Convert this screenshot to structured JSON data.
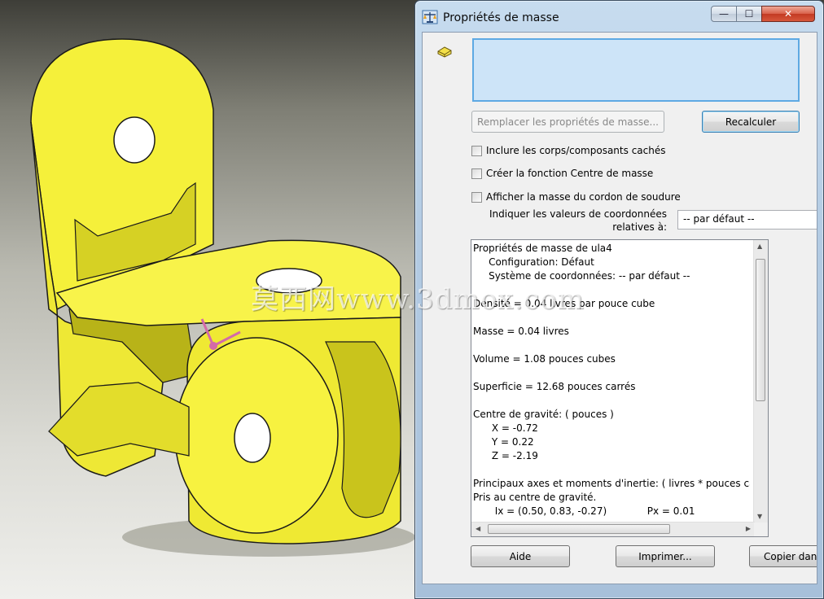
{
  "viewport": {
    "watermark": "莫西网www.3dmox.com"
  },
  "window": {
    "title": "Propriétés de masse",
    "minimize_glyph": "—",
    "maximize_glyph": "☐",
    "close_glyph": "✕"
  },
  "icons": {
    "title": "balance-scale-icon",
    "part": "part-icon"
  },
  "buttons": {
    "replace": "Remplacer les propriétés de masse...",
    "recalc": "Recalculer",
    "help": "Aide",
    "print": "Imprimer...",
    "copy": "Copier dan"
  },
  "options": {
    "include_hidden": "Inclure les corps/composants cachés",
    "create_center": "Créer la fonction Centre de masse",
    "show_weld": "Afficher la masse du cordon de soudure"
  },
  "coordinates": {
    "label_line1": "Indiquer les valeurs de coordonnées",
    "label_line2": "relatives à:",
    "value": "-- par défaut --"
  },
  "results": {
    "lines": [
      "Propriétés de masse de ula4",
      "     Configuration: Défaut",
      "     Système de coordonnées: -- par défaut --",
      "",
      "Densité = 0.04 livres par pouce cube",
      "",
      "Masse = 0.04 livres",
      "",
      "Volume = 1.08 pouces cubes",
      "",
      "Superficie = 12.68 pouces carrés",
      "",
      "Centre de gravité: ( pouces )",
      "      X = -0.72",
      "      Y = 0.22",
      "      Z = -2.19",
      "",
      "Principaux axes et moments d'inertie: ( livres * pouces carrés )",
      "Pris au centre de gravité.",
      "       Ix = (0.50, 0.83, -0.27)             Px = 0.01"
    ]
  },
  "colors": {
    "part_fill": "#f5f03a",
    "part_shadow": "#c9c41c",
    "selection_box": "#cde4f8",
    "selection_border": "#5ea9e3"
  }
}
